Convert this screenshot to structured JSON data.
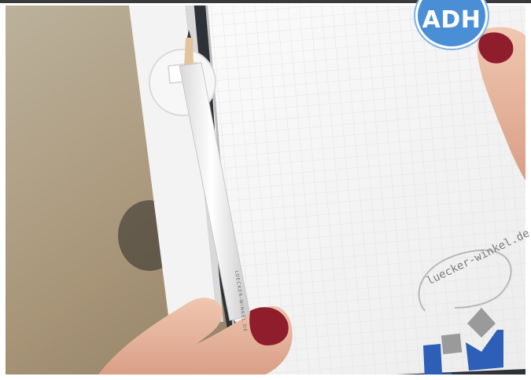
{
  "badge": {
    "text": "ADH"
  },
  "notepad": {
    "logo_url_text": "luecker-winkel.de",
    "logo_name": "LW logo",
    "pen_imprint": "LUECKER-WINKEL.DE"
  },
  "colors": {
    "badge_blue": "#4a8fd6",
    "logo_blue": "#2e5fb8",
    "logo_grey": "#9a9a9a",
    "nail_red": "#8f1d2c",
    "skin": "#e9b8a2",
    "background": "#b7a58b"
  }
}
